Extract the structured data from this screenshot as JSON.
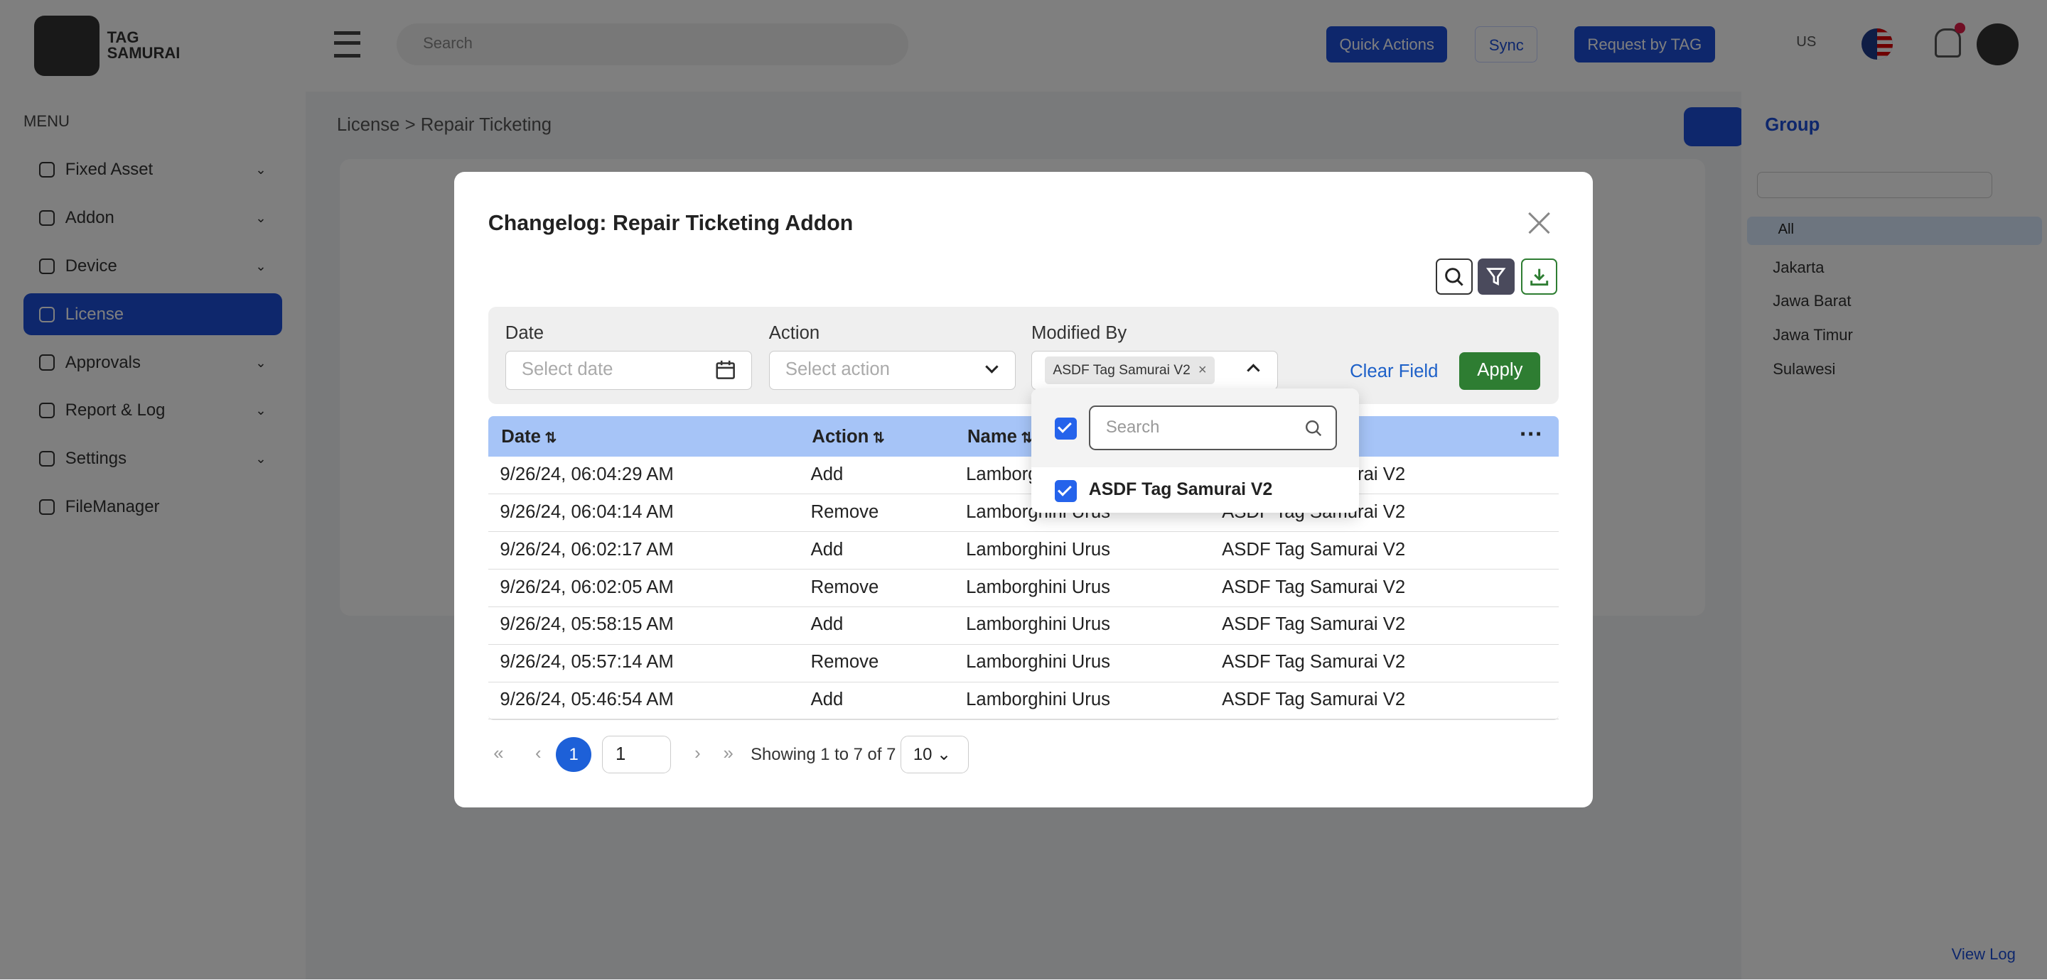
{
  "background": {
    "breadcrumb": "License > Repair Ticketing",
    "menu_title": "MENU",
    "nav": [
      "Fixed Asset",
      "Addon",
      "Device",
      "License",
      "Approvals",
      "Report & Log",
      "Settings",
      "FileManager"
    ],
    "search_placeholder": "Search",
    "top_buttons": [
      "Quick Actions",
      "Sync",
      "Request by TAG"
    ],
    "lang": "US",
    "right_panel_title": "Group",
    "right_panel_items": [
      "All",
      "Jakarta",
      "Jawa Barat",
      "Jawa Timur",
      "Sulawesi"
    ],
    "view_log": "View Log"
  },
  "modal": {
    "title": "Changelog: Repair Ticketing Addon",
    "filters": {
      "date_label": "Date",
      "date_placeholder": "Select date",
      "action_label": "Action",
      "action_placeholder": "Select action",
      "modified_label": "Modified By",
      "modified_tag": "ASDF Tag Samurai V2",
      "clear": "Clear Field",
      "apply": "Apply"
    },
    "dropdown": {
      "search_placeholder": "Search",
      "option": "ASDF Tag Samurai V2"
    },
    "columns": [
      "Date",
      "Action",
      "Name",
      "Modified By"
    ],
    "rows": [
      [
        "9/26/24, 06:04:29 AM",
        "Add",
        "Lamborghini Urus",
        "ASDF Tag Samurai V2"
      ],
      [
        "9/26/24, 06:04:14 AM",
        "Remove",
        "Lamborghini Urus",
        "ASDF Tag Samurai V2"
      ],
      [
        "9/26/24, 06:02:17 AM",
        "Add",
        "Lamborghini Urus",
        "ASDF Tag Samurai V2"
      ],
      [
        "9/26/24, 06:02:05 AM",
        "Remove",
        "Lamborghini Urus",
        "ASDF Tag Samurai V2"
      ],
      [
        "9/26/24, 05:58:15 AM",
        "Add",
        "Lamborghini Urus",
        "ASDF Tag Samurai V2"
      ],
      [
        "9/26/24, 05:57:14 AM",
        "Remove",
        "Lamborghini Urus",
        "ASDF Tag Samurai V2"
      ],
      [
        "9/26/24, 05:46:54 AM",
        "Add",
        "Lamborghini Urus",
        "ASDF Tag Samurai V2"
      ]
    ],
    "pagination": {
      "current": "1",
      "page_input": "1",
      "showing": "Showing 1 to 7 of 7",
      "page_size": "10"
    }
  },
  "colors": {
    "primary": "#1d4ed8",
    "apply": "#2e7d32",
    "header": "#a6c4f7"
  }
}
